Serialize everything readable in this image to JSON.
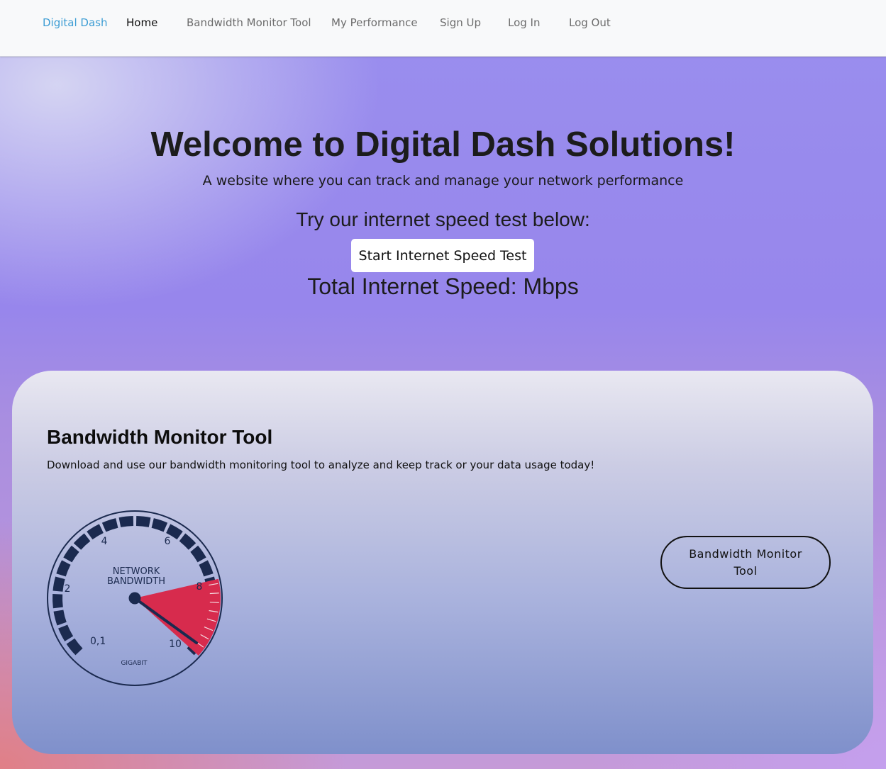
{
  "nav": {
    "brand": "Digital Dash",
    "items": [
      {
        "label": "Home"
      },
      {
        "label": "Bandwidth Monitor Tool"
      },
      {
        "label": "My Performance"
      },
      {
        "label": "Sign Up"
      },
      {
        "label": "Log In"
      },
      {
        "label": "Log Out"
      }
    ]
  },
  "hero": {
    "title": "Welcome to Digital Dash Solutions!",
    "subtitle": "A website where you can track and manage your network performance",
    "try_text": "Try our internet speed test below:",
    "start_button": "Start Internet Speed Test",
    "speed_text": "Total Internet Speed: Mbps"
  },
  "card": {
    "title": "Bandwidth Monitor Tool",
    "description": "Download and use our bandwidth monitoring tool to analyze and keep track or your data usage today!",
    "button": "Bandwidth Monitor Tool",
    "gauge": {
      "label_line1": "NETWORK",
      "label_line2": "BANDWIDTH",
      "unit": "GIGABIT",
      "ticks": [
        "0,1",
        "2",
        "4",
        "6",
        "8",
        "10"
      ]
    }
  },
  "colors": {
    "brand": "#3d9dd4",
    "gauge_navy": "#1b2a4f",
    "gauge_red": "#d72b4d"
  }
}
